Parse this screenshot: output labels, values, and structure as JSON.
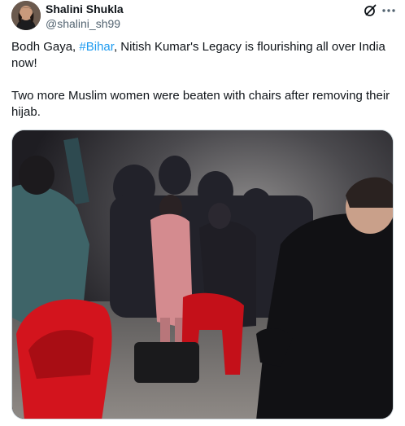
{
  "author": {
    "display_name": "Shalini Shukla",
    "handle": "@shalini_sh99"
  },
  "icons": {
    "grok": "grok-icon",
    "more": "more-options-icon"
  },
  "tweet": {
    "line1_before": "Bodh Gaya, ",
    "hashtag": "#Bihar",
    "line1_after": ", Nitish Kumar's Legacy is flourishing all over India now!",
    "line2": "Two more Muslim women were beaten with chairs after removing their hijab."
  },
  "colors": {
    "hashtag": "#1d9bf0",
    "text": "#0f1419",
    "muted": "#536471"
  }
}
